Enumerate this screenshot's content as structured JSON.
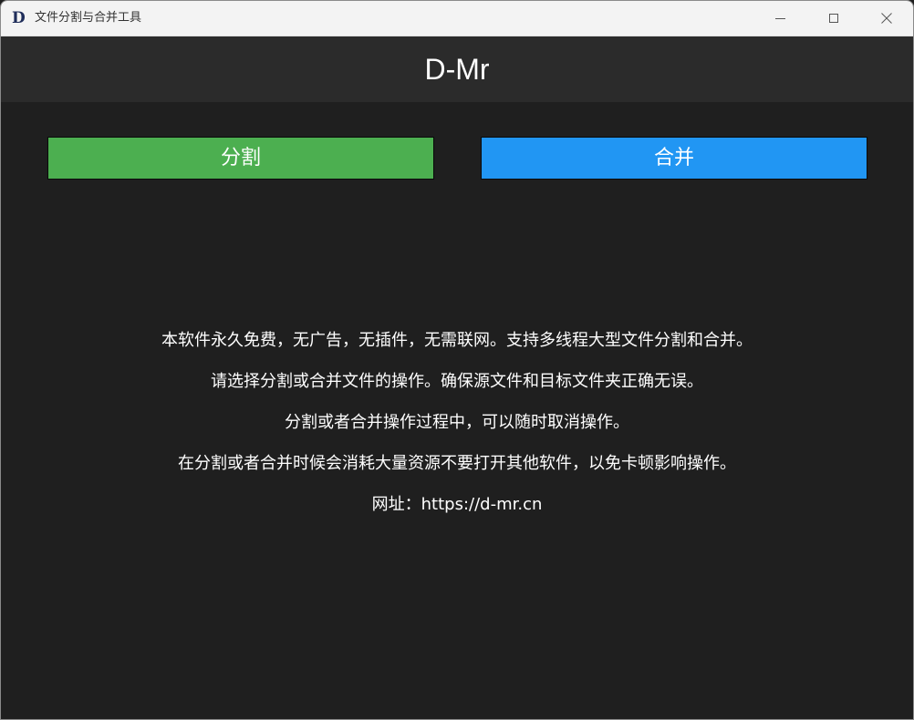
{
  "window": {
    "title": "文件分割与合并工具",
    "icon_letter": "D",
    "controls": [
      "minimize-icon",
      "maximize-icon",
      "close-icon"
    ]
  },
  "header": {
    "brand": "D-Mr"
  },
  "actions": {
    "split_label": "分割",
    "merge_label": "合并",
    "split_color": "#4caf50",
    "merge_color": "#2196f3"
  },
  "info": {
    "lines": [
      "本软件永久免费，无广告，无插件，无需联网。支持多线程大型文件分割和合并。",
      "请选择分割或合并文件的操作。确保源文件和目标文件夹正确无误。",
      "分割或者合并操作过程中，可以随时取消操作。",
      "在分割或者合并时候会消耗大量资源不要打开其他软件，以免卡顿影响操作。",
      "网址：https://d-mr.cn"
    ]
  }
}
